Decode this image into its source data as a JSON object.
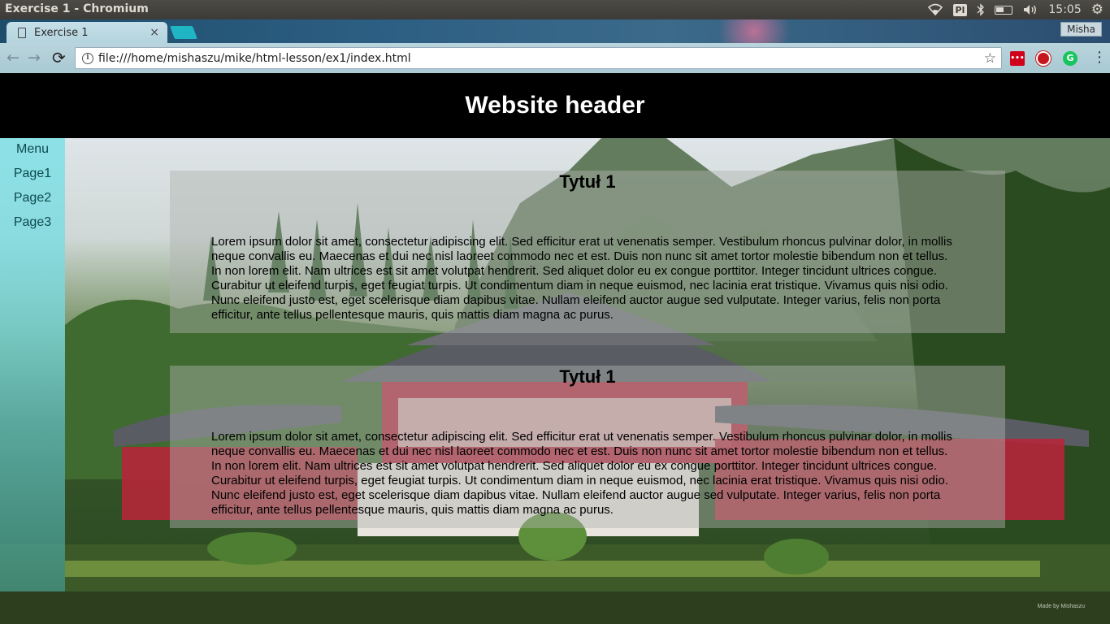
{
  "os_bar": {
    "window_title": "Exercise 1 - Chromium",
    "keyboard_layout": "Pl",
    "clock": "15:05",
    "icons": [
      "wifi-icon",
      "bluetooth-icon",
      "battery-icon",
      "volume-icon",
      "settings-gear-icon"
    ]
  },
  "browser": {
    "tab_title": "Exercise 1",
    "tab_close": "×",
    "profile_name": "Misha",
    "url": "file:///home/mishaszu/mike/html-lesson/ex1/index.html",
    "extensions": [
      "lastpass-extension-icon",
      "opera-extension-icon",
      "grammarly-extension-icon"
    ]
  },
  "site": {
    "header_title": "Website header",
    "menu": {
      "heading": "Menu",
      "items": [
        {
          "label": "Page1"
        },
        {
          "label": "Page2"
        },
        {
          "label": "Page3"
        }
      ]
    },
    "cards": [
      {
        "title": "Tytuł 1",
        "body": "Lorem ipsum dolor sit amet, consectetur adipiscing elit. Sed efficitur erat ut venenatis semper. Vestibulum rhoncus pulvinar dolor, in mollis neque convallis eu. Maecenas et dui nec nisl laoreet commodo nec et est. Duis non nunc sit amet tortor molestie bibendum non et tellus. In non lorem elit. Nam ultrices est sit amet volutpat hendrerit. Sed aliquet dolor eu ex congue porttitor. Integer tincidunt ultrices congue. Curabitur ut eleifend turpis, eget feugiat turpis. Ut condimentum diam in neque euismod, nec lacinia erat tristique. Vivamus quis nisi odio. Nunc eleifend justo est, eget scelerisque diam dapibus vitae. Nullam eleifend auctor augue sed vulputate. Integer varius, felis non porta efficitur, ante tellus pellentesque mauris, quis mattis diam magna ac purus."
      },
      {
        "title": "Tytuł 1",
        "body": "Lorem ipsum dolor sit amet, consectetur adipiscing elit. Sed efficitur erat ut venenatis semper. Vestibulum rhoncus pulvinar dolor, in mollis neque convallis eu. Maecenas et dui nec nisl laoreet commodo nec et est. Duis non nunc sit amet tortor molestie bibendum non et tellus. In non lorem elit. Nam ultrices est sit amet volutpat hendrerit. Sed aliquet dolor eu ex congue porttitor. Integer tincidunt ultrices congue. Curabitur ut eleifend turpis, eget feugiat turpis. Ut condimentum diam in neque euismod, nec lacinia erat tristique. Vivamus quis nisi odio. Nunc eleifend justo est, eget scelerisque diam dapibus vitae. Nullam eleifend auctor augue sed vulputate. Integer varius, felis non porta efficitur, ante tellus pellentesque mauris, quis mattis diam magna ac purus."
      }
    ],
    "footer_credit": "Made by Mishaszu",
    "background_image": "japanese-temple-photo"
  }
}
